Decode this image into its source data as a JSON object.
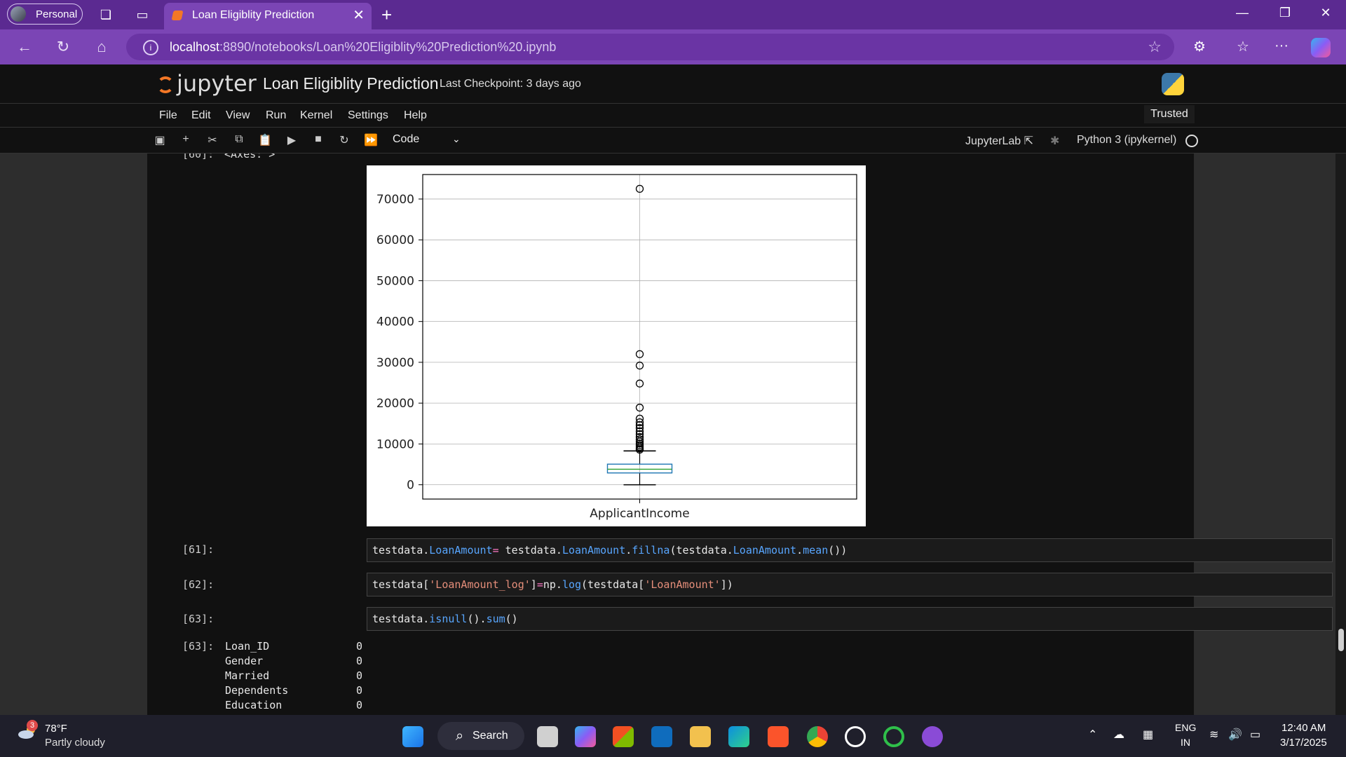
{
  "browser": {
    "profile_label": "Personal",
    "tab_title": "Loan Eligiblity Prediction",
    "url_host": "localhost",
    "url_path": ":8890/notebooks/Loan%20Eligiblity%20Prediction%20.ipynb"
  },
  "jupyter": {
    "logo_text": "jupyter",
    "notebook_title": "Loan Eligiblity Prediction",
    "checkpoint": "Last Checkpoint: 3 days ago",
    "menu": [
      "File",
      "Edit",
      "View",
      "Run",
      "Kernel",
      "Settings",
      "Help"
    ],
    "trusted": "Trusted",
    "cell_type": "Code",
    "jupyterlab_link": "JupyterLab",
    "kernel_name": "Python 3 (ipykernel)"
  },
  "cells": {
    "prev_output_prompt": "[60]:",
    "prev_output_text": "<Axes: >",
    "cell61_prompt": "[61]:",
    "cell62_prompt": "[62]:",
    "cell63_prompt": "[63]:",
    "out63_prompt": "[63]:",
    "out63_rows": [
      {
        "name": "Loan_ID",
        "value": "0"
      },
      {
        "name": "Gender",
        "value": "0"
      },
      {
        "name": "Married",
        "value": "0"
      },
      {
        "name": "Dependents",
        "value": "0"
      },
      {
        "name": "Education",
        "value": "0"
      }
    ]
  },
  "chart_data": {
    "type": "box",
    "xlabel": "ApplicantIncome",
    "ylim": [
      -3500,
      76000
    ],
    "yticks": [
      0,
      10000,
      20000,
      30000,
      40000,
      50000,
      60000,
      70000
    ],
    "box": {
      "whisker_low": 0,
      "q1": 2900,
      "median": 3800,
      "q3": 5050,
      "whisker_high": 8300
    },
    "outliers": [
      72500,
      32000,
      29200,
      24800,
      18900,
      16200,
      15300,
      14600,
      13900,
      13100,
      12400,
      11700,
      11100,
      10600,
      10100,
      9700,
      9300,
      8900,
      8600
    ],
    "grid": true,
    "colors": {
      "box": "#1f77b4",
      "median": "#2ca02c",
      "whisker": "#000000"
    }
  },
  "taskbar": {
    "weather_badge": "3",
    "weather_temp": "78°F",
    "weather_desc": "Partly cloudy",
    "search_label": "Search",
    "lang_line1": "ENG",
    "lang_line2": "IN",
    "time": "12:40 AM",
    "date": "3/17/2025"
  }
}
